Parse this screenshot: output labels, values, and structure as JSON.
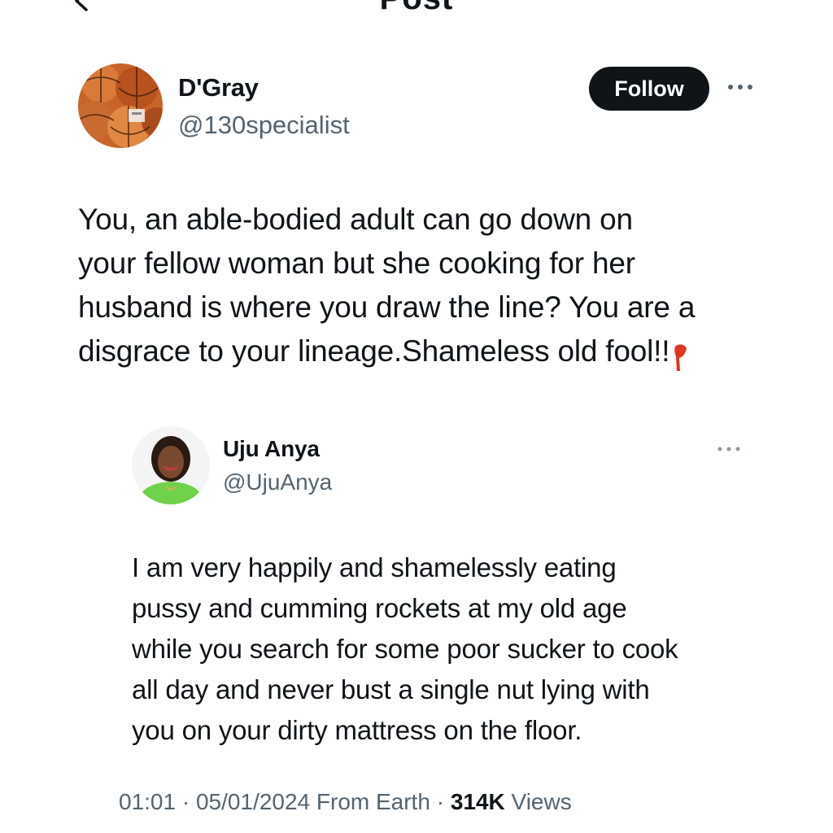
{
  "header": {
    "title": "Post",
    "back_icon": "arrow-left-icon"
  },
  "post": {
    "author": {
      "name": "D'Gray",
      "handle": "@130specialist",
      "avatar_icon": "basketballs-avatar"
    },
    "follow_label": "Follow",
    "more_icon": "more-horizontal-icon",
    "text_lines": [
      "You, an able-bodied adult can go down on",
      "your fellow woman but she cooking for her",
      "husband is where you draw the line? You are a",
      "disgrace to your lineage.Shameless old fool!!"
    ]
  },
  "quoted_post": {
    "author": {
      "name": "Uju Anya",
      "handle": "@UjuAnya",
      "avatar_icon": "profile-photo-avatar"
    },
    "more_icon": "more-horizontal-icon",
    "text_lines": [
      "I am very happily and shamelessly eating",
      "pussy and cumming rockets at my old age",
      "while you search for some poor sucker to cook",
      "all day and never bust a single nut lying with",
      "you on your dirty mattress on the floor."
    ]
  },
  "meta": {
    "time": "01:01",
    "separator": " · ",
    "date_source": "05/01/2024 From Earth",
    "separator2": " · ",
    "views_count": "314K",
    "views_label": " Views"
  },
  "colors": {
    "text": "#0f1419",
    "secondary": "#536471",
    "follow_bg": "#0f1419",
    "cursor_mark": "#e0341c"
  }
}
